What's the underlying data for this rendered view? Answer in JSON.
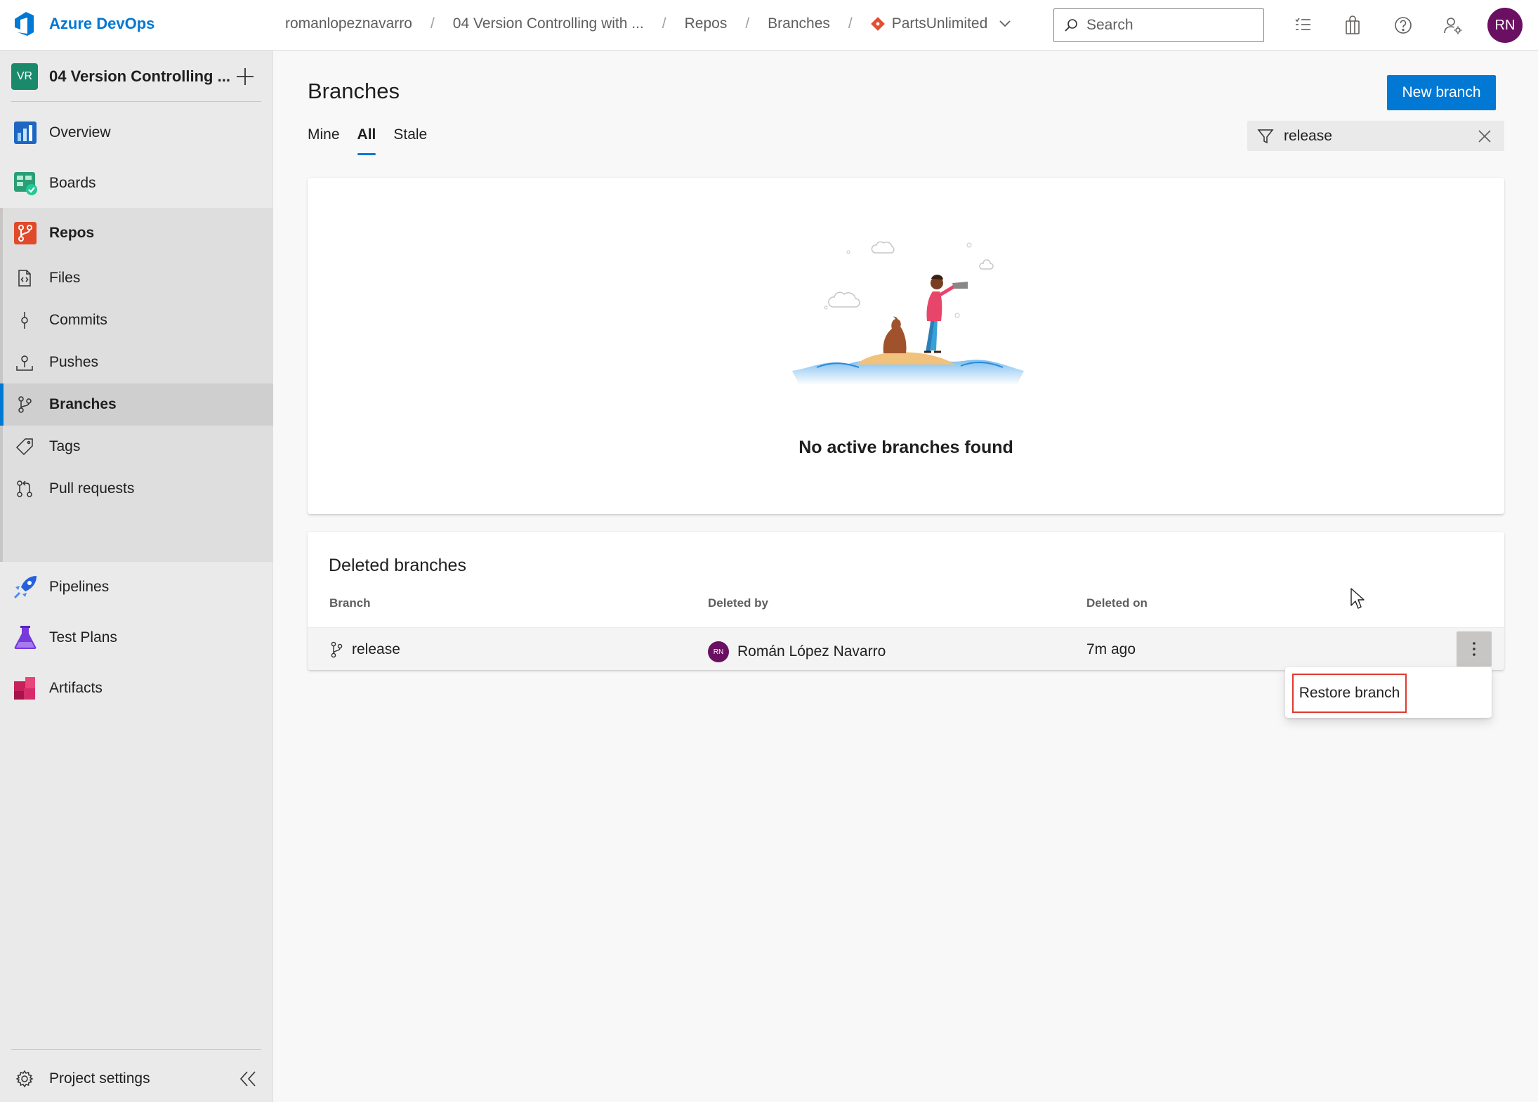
{
  "app": {
    "name": "Azure DevOps"
  },
  "breadcrumb": {
    "organization": "romanlopeznavarro",
    "project": "04 Version Controlling with ...",
    "section": "Repos",
    "page": "Branches",
    "repository": "PartsUnlimited",
    "separator": "/"
  },
  "search": {
    "placeholder": "Search"
  },
  "user": {
    "initials": "RN"
  },
  "sidebar": {
    "project_badge": "VR",
    "project_name": "04 Version Controlling ...",
    "items": {
      "overview": "Overview",
      "boards": "Boards",
      "repos": "Repos",
      "files": "Files",
      "commits": "Commits",
      "pushes": "Pushes",
      "branches": "Branches",
      "tags": "Tags",
      "pull_requests": "Pull requests",
      "pipelines": "Pipelines",
      "test_plans": "Test Plans",
      "artifacts": "Artifacts"
    },
    "settings": "Project settings"
  },
  "main": {
    "title": "Branches",
    "new_branch_label": "New branch",
    "tabs": {
      "mine": "Mine",
      "all": "All",
      "stale": "Stale"
    },
    "filter_value": "release",
    "empty_message": "No active branches found"
  },
  "deleted": {
    "title": "Deleted branches",
    "columns": {
      "branch": "Branch",
      "deleted_by": "Deleted by",
      "deleted_on": "Deleted on"
    },
    "rows": [
      {
        "branch": "release",
        "avatar": "RN",
        "deleted_by": "Román López Navarro",
        "deleted_on": "7m ago"
      }
    ]
  },
  "context_menu": {
    "restore": "Restore branch"
  },
  "colors": {
    "accent": "#0078d4",
    "avatar": "#6b0f62",
    "highlight": "#e03a2f"
  }
}
